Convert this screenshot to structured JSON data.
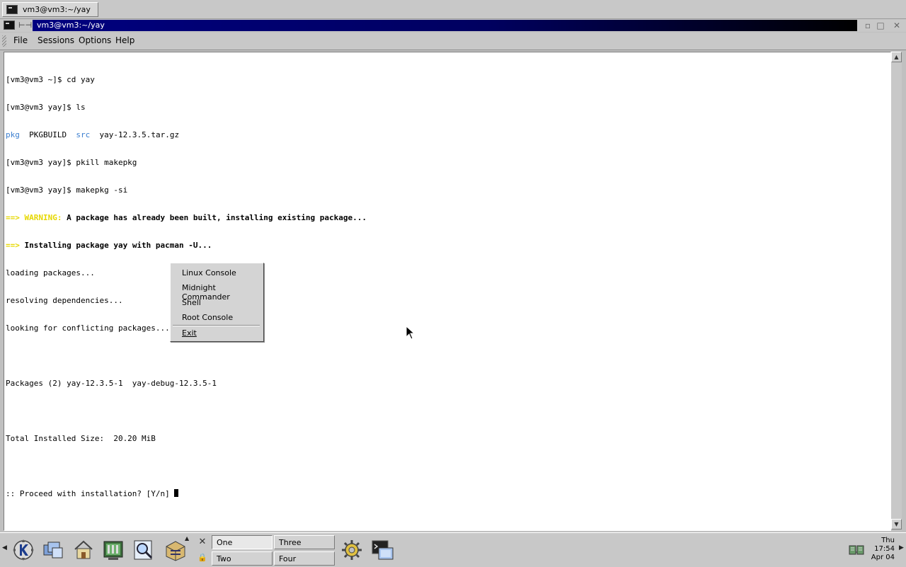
{
  "taskbar_top": {
    "task_label": "vm3@vm3:~/yay"
  },
  "window": {
    "title": "vm3@vm3:~/yay",
    "pin_glyph": "⊢⊣",
    "min_glyph": "▫",
    "max_glyph": "□",
    "close_glyph": "✕"
  },
  "menubar": {
    "file": "File",
    "sessions": "Sessions",
    "options": "Options",
    "help": "Help"
  },
  "terminal": {
    "line1": "[vm3@vm3 ~]$ cd yay",
    "line2": "[vm3@vm3 yay]$ ls",
    "ls_pkg": "pkg",
    "ls_pkgbuild": "  PKGBUILD  ",
    "ls_src": "src",
    "ls_tar": "  yay-12.3.5.tar.gz",
    "line4": "[vm3@vm3 yay]$ pkill makepkg",
    "line5": "[vm3@vm3 yay]$ makepkg -si",
    "warn_prefix": "==> WARNING:",
    "warn_text": " A package has already been built, installing existing package...",
    "install_prefix": "==>",
    "install_text": " Installing package yay with pacman -U...",
    "line8": "loading packages...",
    "line9": "resolving dependencies...",
    "line10": "looking for conflicting packages...",
    "line12": "Packages (2) yay-12.3.5-1  yay-debug-12.3.5-1",
    "line14": "Total Installed Size:  20.20 MiB",
    "line16": ":: Proceed with installation? [Y/n] "
  },
  "context_menu": {
    "items": [
      "Linux Console",
      "Midnight Commander",
      "Shell",
      "Root Console"
    ],
    "exit": "Exit"
  },
  "panel": {
    "desktops": [
      "One",
      "Two",
      "Three",
      "Four"
    ],
    "active_desktop": "One",
    "clock_day": "Thu",
    "clock_time": "17:54",
    "clock_date": "Apr 04"
  },
  "colors": {
    "titlebar_active": "#000080",
    "ls_dir": "#3a7ecf",
    "warning": "#e6d800"
  }
}
